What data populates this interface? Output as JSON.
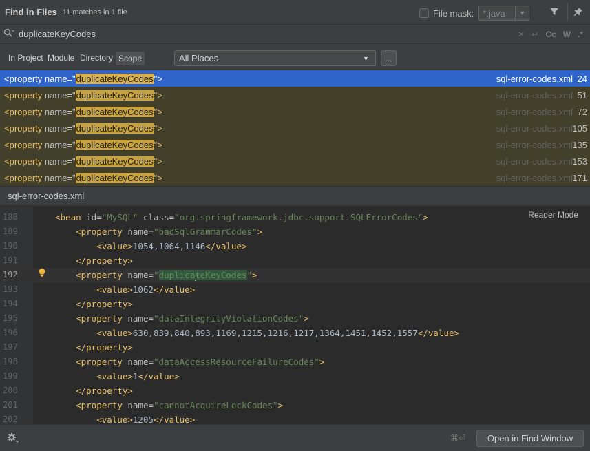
{
  "header": {
    "title": "Find in Files",
    "match_count": "11 matches in 1 file",
    "file_mask_label": "File mask:",
    "file_mask_value": "*.java",
    "icons": [
      "filter-icon",
      "pin-icon"
    ]
  },
  "search": {
    "query": "duplicateKeyCodes",
    "options": [
      "Cc",
      "W"
    ]
  },
  "scope": {
    "tabs": [
      "In Project",
      "Module",
      "Directory",
      "Scope"
    ],
    "selected_tab": "Scope",
    "places": "All Places",
    "more_label": "..."
  },
  "results": [
    {
      "prefix": "<property ",
      "attr": "name=\"",
      "match": "duplicateKeyCodes",
      "suffix": "\">",
      "file": "sql-error-codes.xml",
      "line": "24",
      "selected": true
    },
    {
      "prefix": "<property ",
      "attr": "name=\"",
      "match": "duplicateKeyCodes",
      "suffix": "\">",
      "file": "sql-error-codes.xml",
      "line": "51"
    },
    {
      "prefix": "<property ",
      "attr": "name=\"",
      "match": "duplicateKeyCodes",
      "suffix": "\">",
      "file": "sql-error-codes.xml",
      "line": "72"
    },
    {
      "prefix": "<property ",
      "attr": "name=\"",
      "match": "duplicateKeyCodes",
      "suffix": "\">",
      "file": "sql-error-codes.xml",
      "line": "105"
    },
    {
      "prefix": "<property ",
      "attr": "name=\"",
      "match": "duplicateKeyCodes",
      "suffix": "\">",
      "file": "sql-error-codes.xml",
      "line": "135"
    },
    {
      "prefix": "<property ",
      "attr": "name=\"",
      "match": "duplicateKeyCodes",
      "suffix": "\">",
      "file": "sql-error-codes.xml",
      "line": "153"
    },
    {
      "prefix": "<property ",
      "attr": "name=\"",
      "match": "duplicateKeyCodes",
      "suffix": "\">",
      "file": "sql-error-codes.xml",
      "line": "171"
    }
  ],
  "preview": {
    "file_name": "sql-error-codes.xml",
    "reader_mode": "Reader Mode",
    "current_line": "192",
    "lines": [
      {
        "n": "188",
        "indent": "",
        "tag": "<bean ",
        "attr1": "id=",
        "str1": "\"MySQL\"",
        "attr2": " class=",
        "str2": "\"org.springframework.jdbc.support.SQLErrorCodes\"",
        "close": ">"
      },
      {
        "n": "189",
        "indent": "    ",
        "tag": "<property ",
        "attr1": "name=",
        "str1": "\"badSqlGrammarCodes\"",
        "close": ">"
      },
      {
        "n": "190",
        "indent": "        ",
        "tag": "<value>",
        "text": "1054,1064,1146",
        "close": "</value>"
      },
      {
        "n": "191",
        "indent": "    ",
        "tag": "</property>"
      },
      {
        "n": "192",
        "indent": "    ",
        "tag": "<property ",
        "attr1": "name=",
        "str1a": "\"",
        "str1b": "duplica",
        "str1c": "teKeyCodes",
        "str1d": "\"",
        "close": ">",
        "current": true
      },
      {
        "n": "193",
        "indent": "        ",
        "tag": "<value>",
        "text": "1062",
        "close": "</value>"
      },
      {
        "n": "194",
        "indent": "    ",
        "tag": "</property>"
      },
      {
        "n": "195",
        "indent": "    ",
        "tag": "<property ",
        "attr1": "name=",
        "str1": "\"dataIntegrityViolationCodes\"",
        "close": ">"
      },
      {
        "n": "196",
        "indent": "        ",
        "tag": "<value>",
        "text": "630,839,840,893,1169,1215,1216,1217,1364,1451,1452,1557",
        "close": "</value>"
      },
      {
        "n": "197",
        "indent": "    ",
        "tag": "</property>"
      },
      {
        "n": "198",
        "indent": "    ",
        "tag": "<property ",
        "attr1": "name=",
        "str1": "\"dataAccessResourceFailureCodes\"",
        "close": ">"
      },
      {
        "n": "199",
        "indent": "        ",
        "tag": "<value>",
        "text": "1",
        "close": "</value>"
      },
      {
        "n": "200",
        "indent": "    ",
        "tag": "</property>"
      },
      {
        "n": "201",
        "indent": "    ",
        "tag": "<property ",
        "attr1": "name=",
        "str1": "\"cannotAcquireLockCodes\"",
        "close": ">"
      },
      {
        "n": "202",
        "indent": "        ",
        "tag": "<value>",
        "text": "1205",
        "close": "</value>"
      }
    ]
  },
  "footer": {
    "shortcut": "⌘⏎",
    "open_button": "Open in Find Window"
  },
  "colors": {
    "selected_row": "#2f65ca",
    "match_row": "#423f2a",
    "highlight": "#c9a33f",
    "xml_tag": "#e8bf6a",
    "xml_string": "#6a8759"
  }
}
